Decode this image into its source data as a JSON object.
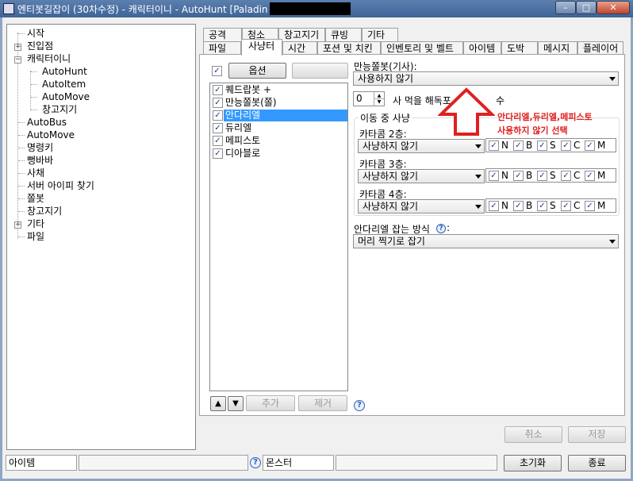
{
  "window": {
    "title": "엔티봇길잡이 (30차수정) - 캐릭터이니 - AutoHunt [Paladin",
    "min_glyph": "–",
    "max_glyph": "□",
    "close_glyph": "✕"
  },
  "tree": {
    "items": [
      {
        "label": "시작"
      },
      {
        "label": "진입점"
      },
      {
        "label": "캐릭터이니"
      },
      {
        "label": "AutoHunt"
      },
      {
        "label": "AutoItem"
      },
      {
        "label": "AutoMove"
      },
      {
        "label": "창고지기"
      },
      {
        "label": "AutoBus"
      },
      {
        "label": "AutoMove"
      },
      {
        "label": "명령키"
      },
      {
        "label": "뻥바바"
      },
      {
        "label": "사채"
      },
      {
        "label": "서버 아이피 찾기"
      },
      {
        "label": "쫄봇"
      },
      {
        "label": "창고지기"
      },
      {
        "label": "기타"
      },
      {
        "label": "파일"
      }
    ],
    "plus": "+",
    "minus": "−"
  },
  "tabs_top": [
    "공격",
    "청소",
    "창고지기",
    "큐빙",
    "기타"
  ],
  "tabs_bottom": [
    "파일",
    "사냥터",
    "시간",
    "포션 및 치킨",
    "인벤토리 및 벨트",
    "아이템",
    "도박",
    "메시지",
    "플레이어"
  ],
  "options_button": "옵션",
  "monster_list": [
    {
      "label": "퀘드랍봇 +",
      "checked": true,
      "selected": false
    },
    {
      "label": "만능쫄봇(쫄)",
      "checked": true,
      "selected": false
    },
    {
      "label": "안다리엘",
      "checked": true,
      "selected": true
    },
    {
      "label": "듀리엘",
      "checked": true,
      "selected": false
    },
    {
      "label": "메피스토",
      "checked": true,
      "selected": false
    },
    {
      "label": "디아블로",
      "checked": true,
      "selected": false
    }
  ],
  "list_controls": {
    "up": "▲",
    "down": "▼",
    "add": "추가",
    "remove": "제거"
  },
  "check_mark": "✓",
  "right": {
    "universal_label": "만능쫄봇(기사):",
    "universal_value": "사용하지 않기",
    "spin_value": "0",
    "spin_label": "사 먹을 해독포",
    "spin_label_tail": "수",
    "group_title": "이동 중 사냥",
    "floors": [
      {
        "label": "카타콤 2층:",
        "value": "사냥하지 않기"
      },
      {
        "label": "카타콤 3층:",
        "value": "사냥하지 않기"
      },
      {
        "label": "카타콤 4층:",
        "value": "사냥하지 않기"
      }
    ],
    "flag_letters": [
      "N",
      "B",
      "S",
      "C",
      "M"
    ],
    "andariel_label": "안다리엘 잡는 방식",
    "andariel_colon": ":",
    "andariel_value": "머리 찍기로 잡기"
  },
  "annotation": {
    "line1": "안다리엘,듀리엘,메피스토",
    "line2": "사용하지 않기 선택",
    "color": "#e0201e"
  },
  "buttons": {
    "cancel": "취소",
    "save": "저장",
    "reset": "초기화",
    "exit": "종료"
  },
  "status": {
    "item_label": "아이템",
    "monster_label": "몬스터",
    "help": "?"
  }
}
